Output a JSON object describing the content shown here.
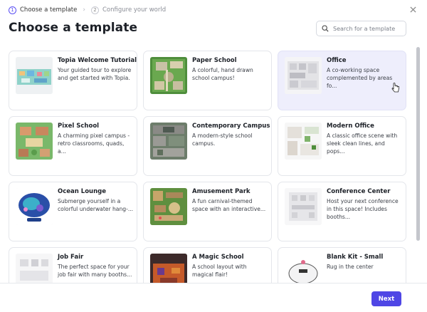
{
  "breadcrumb": {
    "steps": [
      {
        "number": "1",
        "label": "Choose a template"
      },
      {
        "number": "2",
        "label": "Configure your world"
      }
    ],
    "separator": "›"
  },
  "page_title": "Choose a template",
  "search": {
    "placeholder": "Search for a template",
    "value": ""
  },
  "templates": [
    {
      "title": "Topia Welcome Tutorial",
      "description": "Your guided tour to explore and get started with Topia."
    },
    {
      "title": "Paper School",
      "description": "A colorful, hand drawn school campus!"
    },
    {
      "title": "Office",
      "description": "A co-working space complemented by areas fo..."
    },
    {
      "title": "Pixel School",
      "description": "A charming pixel campus - retro classrooms, quads, a..."
    },
    {
      "title": "Contemporary Campus",
      "description": "A modern-style school campus."
    },
    {
      "title": "Modern Office",
      "description": "A classic office scene with sleek clean lines, and pops..."
    },
    {
      "title": "Ocean Lounge",
      "description": "Submerge yourself in a colorful underwater hang-..."
    },
    {
      "title": "Amusement Park",
      "description": "A fun carnival-themed space with an interactive..."
    },
    {
      "title": "Conference Center",
      "description": "Host your next conference in this space! Includes booths..."
    },
    {
      "title": "Job Fair",
      "description": "The perfect space for your job fair with many booths..."
    },
    {
      "title": "A Magic School",
      "description": "A school layout with magical flair!"
    },
    {
      "title": "Blank Kit - Small",
      "description": "Rug in the center"
    }
  ],
  "footer": {
    "next_label": "Next"
  },
  "colors": {
    "accent": "#4f46e5",
    "selected_card": "#eeeefc"
  }
}
